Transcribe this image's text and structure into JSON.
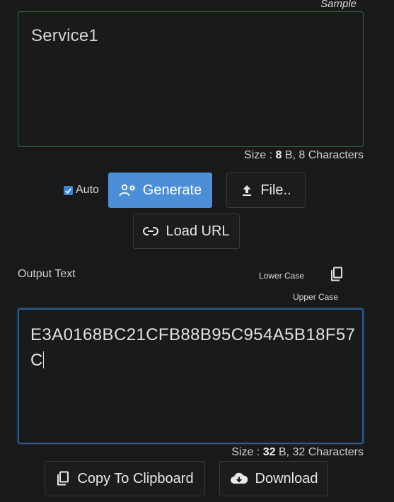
{
  "sample": {
    "label": "Sample",
    "input_value": "Service1",
    "size_prefix": "Size : ",
    "size_value": "8",
    "size_suffix": " B, 8 Characters"
  },
  "controls": {
    "auto_label": "Auto",
    "auto_checked": true,
    "generate_label": "Generate",
    "file_label": "File..",
    "load_url_label": "Load URL"
  },
  "output": {
    "label": "Output Text",
    "lower_case_label": "Lower Case",
    "upper_case_label": "Upper Case",
    "value": "E3A0168BC21CFB88B95C954A5B18F57C",
    "size_prefix": "Size : ",
    "size_value": "32",
    "size_suffix": " B, 32 Characters",
    "copy_label": "Copy To Clipboard",
    "download_label": "Download"
  },
  "colors": {
    "accent": "#4c8fd8",
    "input_border": "#2f6b3d",
    "output_border": "#2e5a8a",
    "background": "#191919"
  }
}
